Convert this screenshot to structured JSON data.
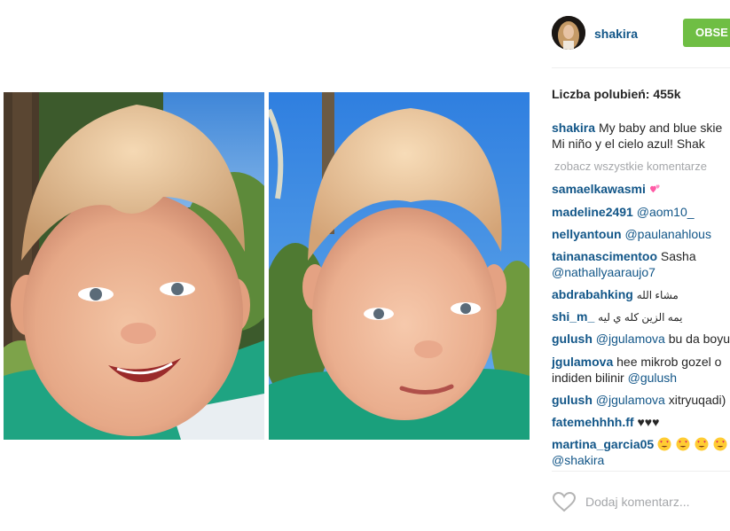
{
  "post": {
    "images": [
      {
        "alt_icon": "baby-photo-smiling"
      },
      {
        "alt_icon": "baby-photo-neutral"
      }
    ]
  },
  "header": {
    "username": "shakira",
    "follow_label": "OBSE"
  },
  "likes": {
    "label": "Liczba polubień: 455k"
  },
  "caption": {
    "username": "shakira",
    "line1": "My baby and blue skie",
    "line2": "Mi niño y el cielo azul! Shak"
  },
  "see_all_comments": " zobacz wszystkie komentarze",
  "comments": [
    {
      "user": "samaelkawasmi",
      "text": "",
      "emoji": "two-hearts-icon"
    },
    {
      "user": "madeline2491",
      "mention": "@aom10_",
      "text": ""
    },
    {
      "user": "nellyantoun",
      "mention": "@paulanahlous",
      "text": ""
    },
    {
      "user": "tainanascimentoo",
      "text": "Sasha",
      "line2_mention": "@nathallyaaraujo7"
    },
    {
      "user": "abdrabahking",
      "text": "مشاء الله"
    },
    {
      "user": "shi_m_",
      "text": "يمه الزين كله ي ليه"
    },
    {
      "user": "gulush",
      "mention": "@jgulamova",
      "text": "bu da boyu"
    },
    {
      "user": "jgulamova",
      "text": "hee mikrob gozel o",
      "line2_text": "indiden bilinir",
      "line2_mention": "@gulush"
    },
    {
      "user": "gulush",
      "mention": "@jgulamova",
      "text": "xitryuqadi)"
    },
    {
      "user": "fatemehhhh.ff",
      "text": "♥♥♥"
    },
    {
      "user": "martina_garcia05",
      "text": "",
      "emoji": "heart-eyes-face-icon",
      "line2_mention": "@shakira"
    }
  ],
  "footer": {
    "comment_placeholder": "Dodaj komentarz..."
  },
  "colors": {
    "brand_blue": "#125688",
    "follow_green": "#6fbe44",
    "muted_gray": "#a5a7aa",
    "text": "#262626"
  }
}
